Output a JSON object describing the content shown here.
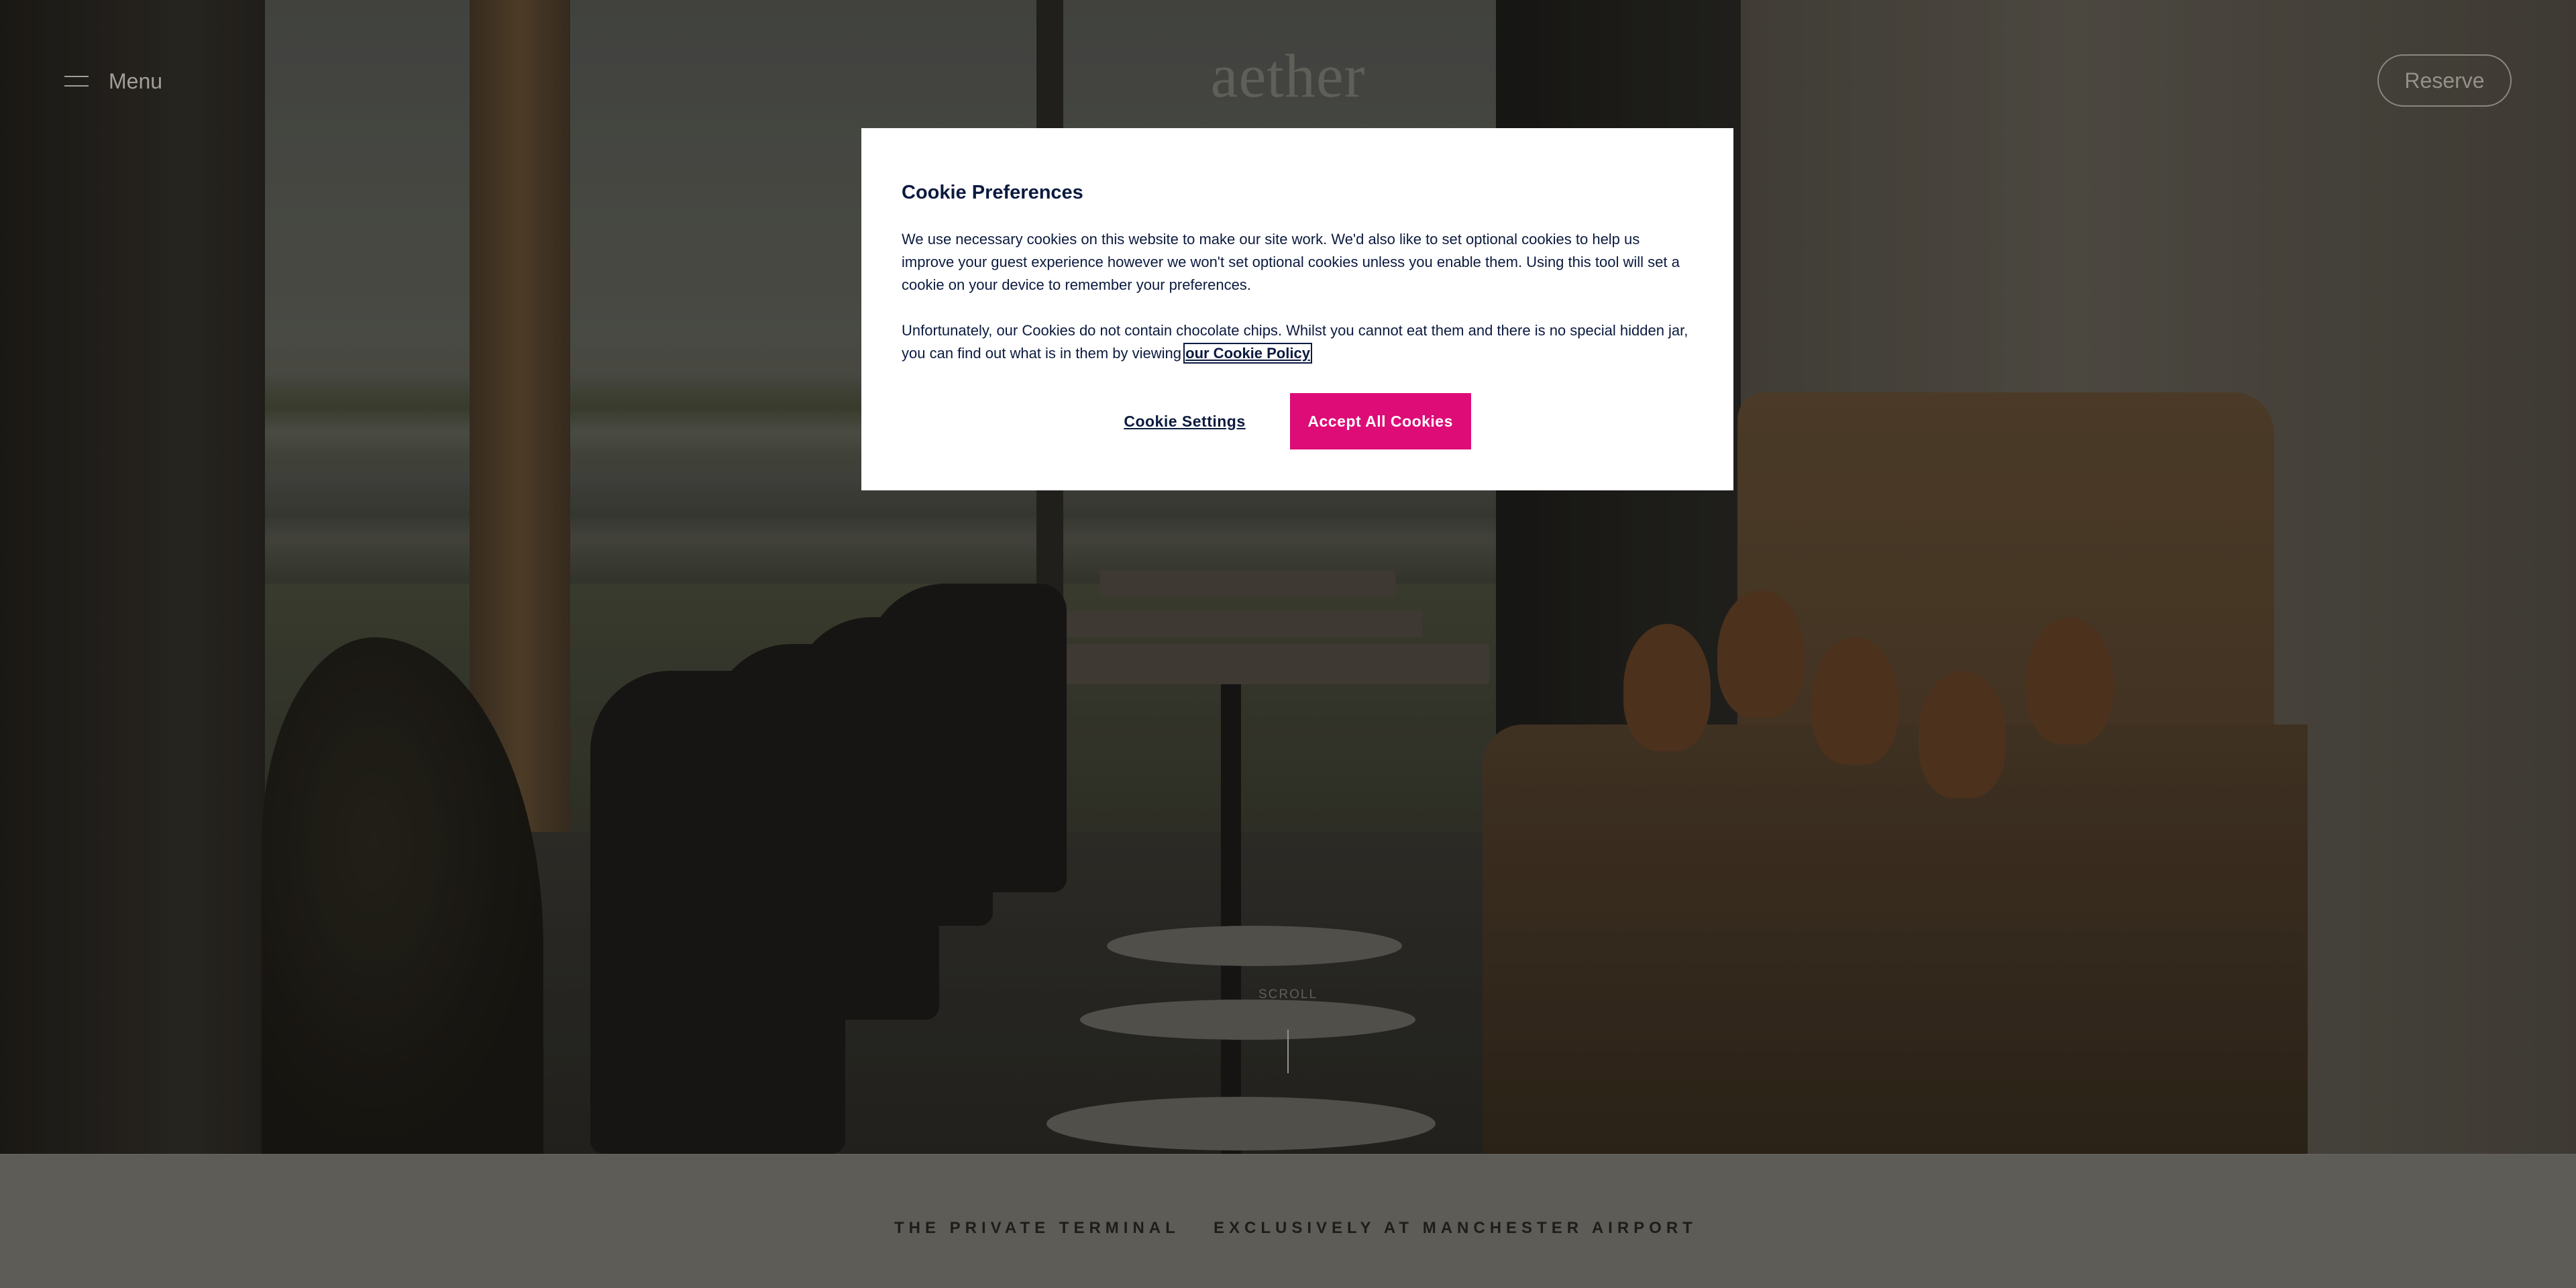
{
  "header": {
    "menu_label": "Menu",
    "logo_text": "aether",
    "reserve_label": "Reserve"
  },
  "hero": {
    "scroll_label": "SCROLL"
  },
  "strip": {
    "left_text": "THE PRIVATE TERMINAL",
    "right_text": "EXCLUSIVELY AT MANCHESTER AIRPORT"
  },
  "cookie_modal": {
    "title": "Cookie Preferences",
    "paragraph1": "We use necessary cookies on this website to make our site work. We'd also like to set optional cookies to help us improve your guest experience however we won't set optional cookies unless you enable them. Using this tool will set a cookie on your device to remember your preferences.",
    "paragraph2_text": "Unfortunately, our Cookies do not contain chocolate chips. Whilst you cannot eat them and there is no special hidden jar, you can find out what is in them by viewing ",
    "policy_link": "our Cookie Policy",
    "settings_button": "Cookie Settings",
    "accept_button": "Accept All Cookies"
  },
  "icons": {
    "menu": "hamburger-icon"
  },
  "colors": {
    "accept_button": "#dd0c77",
    "modal_text": "#0b1a3f",
    "modal_bg": "#ffffff",
    "strip_bg": "#6a6962"
  }
}
